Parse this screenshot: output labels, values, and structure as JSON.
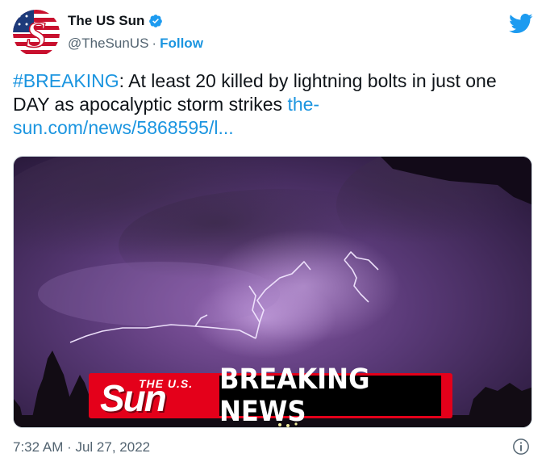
{
  "author": {
    "display_name": "The US Sun",
    "handle": "@TheSunUS",
    "separator": "·",
    "follow_label": "Follow"
  },
  "tweet": {
    "hashtag": "#BREAKING",
    "text": ": At least 20 killed by lightning bolts in just one DAY as apocalyptic storm strikes ",
    "link_text": "the-sun.com/news/5868595/l...",
    "timestamp": "7:32 AM · Jul 27, 2022"
  },
  "media": {
    "banner_small": "THE U.S.",
    "banner_logo": "Sun",
    "banner_text": "BREAKING NEWS"
  },
  "icons": {
    "verified": "verified-badge-icon",
    "platform": "twitter-bird-icon",
    "info": "info-icon"
  },
  "colors": {
    "link": "#1b95e0",
    "verified": "#1d9bf0",
    "banner_red": "#e4001a",
    "muted": "#536471"
  }
}
